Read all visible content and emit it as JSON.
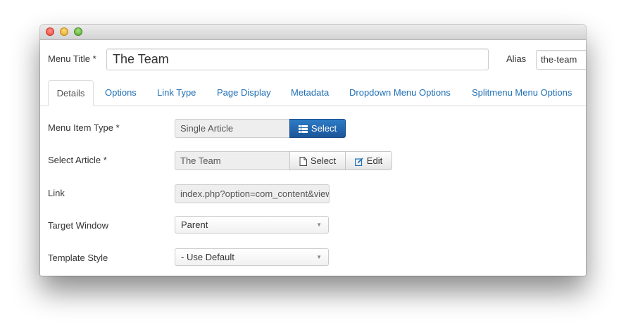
{
  "window": {
    "controls": [
      "close-button",
      "minimize-button",
      "zoom-button"
    ]
  },
  "header": {
    "menu_title_label": "Menu Title *",
    "menu_title_value": "The Team",
    "alias_label": "Alias",
    "alias_value": "the-team"
  },
  "tabs": [
    {
      "label": "Details",
      "active": true
    },
    {
      "label": "Options"
    },
    {
      "label": "Link Type"
    },
    {
      "label": "Page Display"
    },
    {
      "label": "Metadata"
    },
    {
      "label": "Dropdown Menu Options"
    },
    {
      "label": "Splitmenu Menu Options"
    }
  ],
  "form": {
    "menu_item_type": {
      "label": "Menu Item Type *",
      "value": "Single Article",
      "button": "Select",
      "button_icon": "list-icon"
    },
    "select_article": {
      "label": "Select Article *",
      "value": "The Team",
      "select_button": "Select",
      "select_icon": "file-icon",
      "edit_button": "Edit",
      "edit_icon": "edit-icon"
    },
    "link": {
      "label": "Link",
      "value": "index.php?option=com_content&view=article"
    },
    "target_window": {
      "label": "Target Window",
      "value": "Parent"
    },
    "template_style": {
      "label": "Template Style",
      "value": "- Use Default"
    }
  },
  "colors": {
    "link": "#1f6fb5",
    "primary": "#1a5598"
  }
}
